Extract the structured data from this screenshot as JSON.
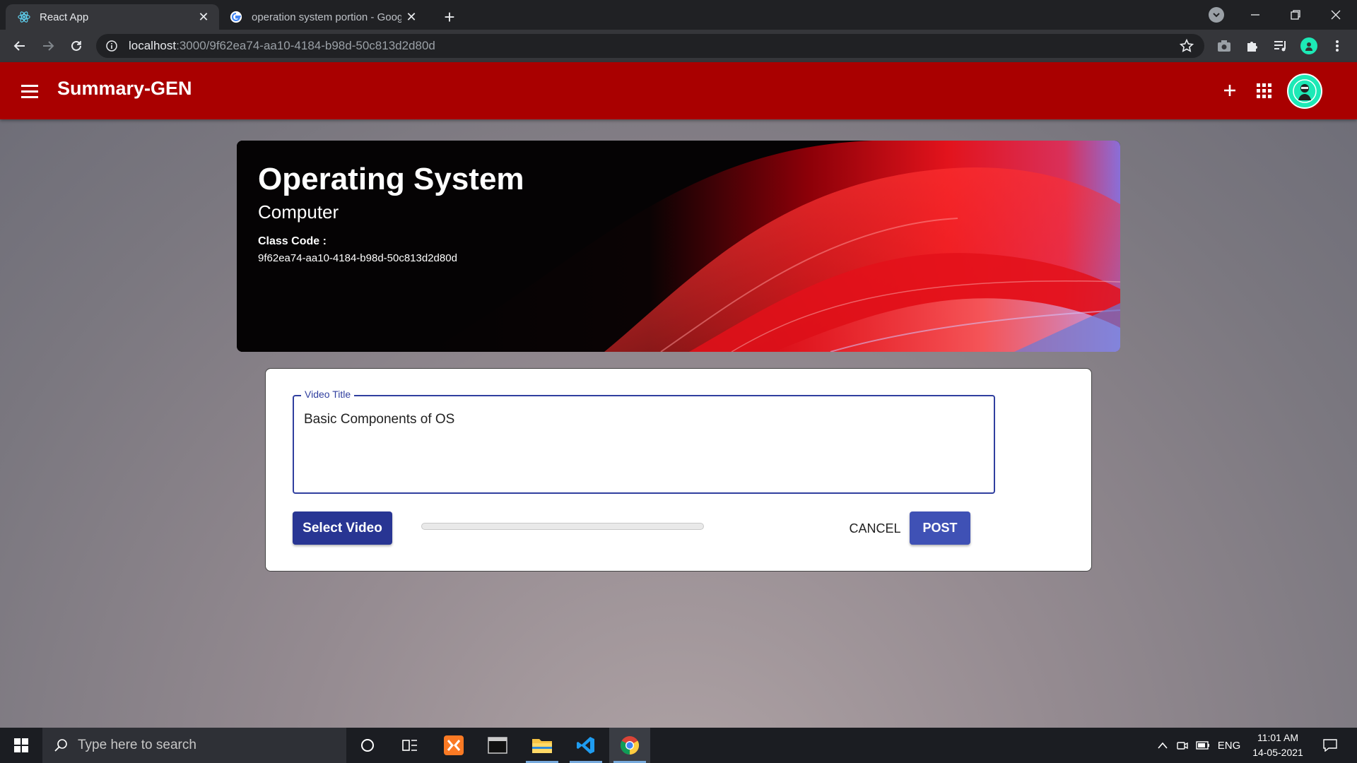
{
  "browser": {
    "tabs": [
      {
        "title": "React App",
        "active": true
      },
      {
        "title": "operation system portion - Goog",
        "active": false
      }
    ],
    "url_host": "localhost",
    "url_path": ":3000/9f62ea74-aa10-4184-b98d-50c813d2d80d"
  },
  "app": {
    "brand": "Summary-GEN",
    "accent_color": "#a90000"
  },
  "banner": {
    "title": "Operating System",
    "subtitle": "Computer",
    "class_code_label": "Class Code :",
    "class_code": "9f62ea74-aa10-4184-b98d-50c813d2d80d"
  },
  "upload": {
    "field_label": "Video Title",
    "field_value": "Basic Components of OS",
    "select_label": "Select Video",
    "progress": 0,
    "cancel_label": "CANCEL",
    "post_label": "POST"
  },
  "taskbar": {
    "search_placeholder": "Type here to search",
    "language": "ENG",
    "time": "11:01 AM",
    "date": "14-05-2021"
  }
}
